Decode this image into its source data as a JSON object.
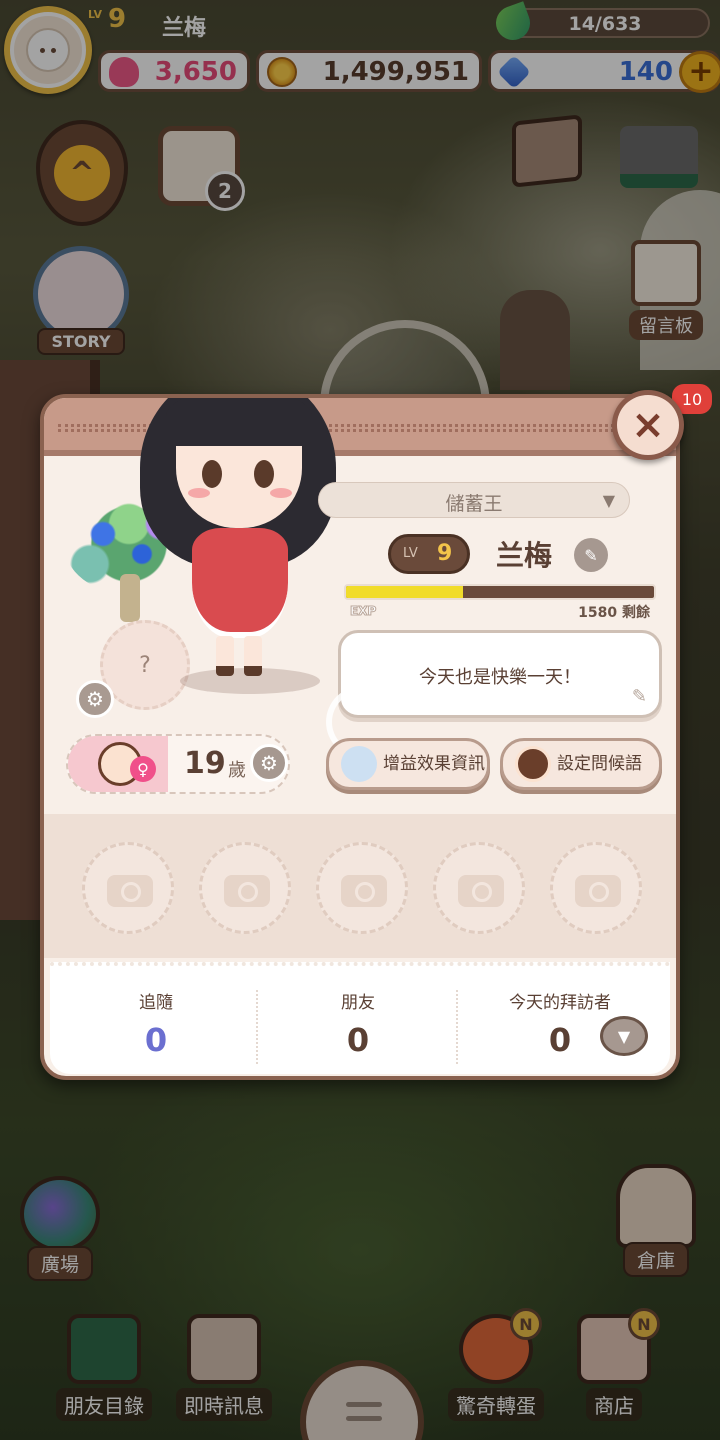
{
  "player": {
    "lv_tag": "LV",
    "level": "9",
    "name": "兰梅"
  },
  "resources": {
    "leaves": "14/633",
    "hearts": "3,650",
    "coins": "1,499,951",
    "gems": "140",
    "plus": "+"
  },
  "side_buttons": {
    "story_label": "STORY",
    "calendar_badge": "2",
    "board_label": "留言板"
  },
  "modal": {
    "close": "×",
    "title_badge": "儲蓄王",
    "lv_tag": "LV",
    "level": "9",
    "name": "兰梅",
    "exp_label": "EXP",
    "exp_progress": 0.38,
    "exp_remain": "1580 剩餘",
    "greeting": "今天也是快樂一天！",
    "age": "19",
    "age_unit": "歲",
    "slot_question": "?",
    "buff_label": "增益效果資訊",
    "greet_label": "設定問候語",
    "stats": {
      "follow_label": "追隨",
      "follow_value": "0",
      "friends_label": "朋友",
      "friends_value": "0",
      "visitors_label": "今天的拜訪者",
      "visitors_value": "0"
    }
  },
  "bottom": {
    "plaza": "廣場",
    "warehouse": "倉庫",
    "friends_list": "朋友目錄",
    "messages": "即時訊息",
    "gacha": "驚奇轉蛋",
    "shop": "商店",
    "new_badge": "N",
    "side_badge": "10"
  },
  "colors": {
    "accent_gold": "#f3c44a",
    "heart_pink": "#e94b7a",
    "gem_blue": "#3a6fd8",
    "exp_yellow": "#f1dc2a",
    "follow_purple": "#6b6fd0"
  }
}
